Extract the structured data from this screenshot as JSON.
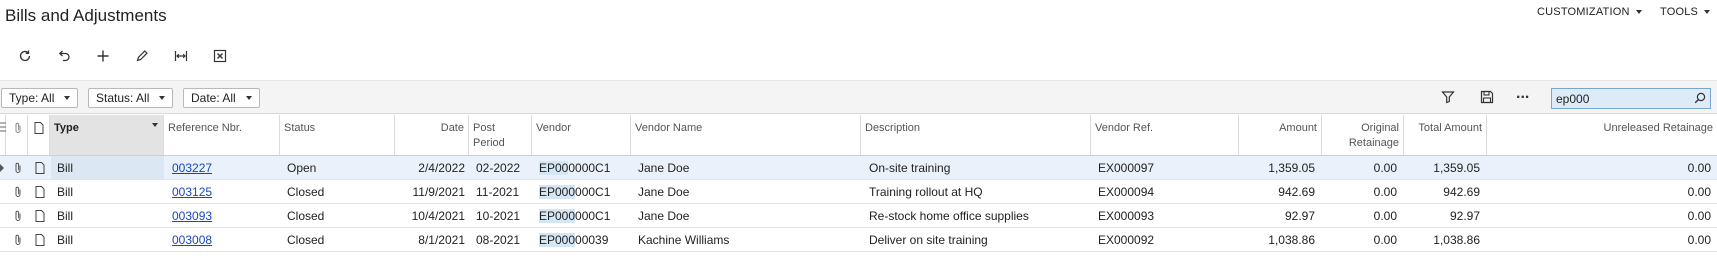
{
  "page": {
    "title": "Bills and Adjustments"
  },
  "top_menu": {
    "customization": "CUSTOMIZATION",
    "tools": "TOOLS"
  },
  "toolbar": [
    "refresh-icon",
    "undo-icon",
    "add-icon",
    "edit-icon",
    "fit-columns-icon",
    "export-excel-icon"
  ],
  "filters": {
    "type": "Type: All",
    "status": "Status: All",
    "date": "Date: All"
  },
  "search": {
    "value": "ep000",
    "more_label": "..."
  },
  "columns": {
    "type": "Type",
    "ref": "Reference Nbr.",
    "status": "Status",
    "date": "Date",
    "post_period": "Post Period",
    "vendor": "Vendor",
    "vendor_name": "Vendor Name",
    "description": "Description",
    "vendor_ref": "Vendor Ref.",
    "amount": "Amount",
    "orig_retainage": "Original Retainage",
    "total_amount": "Total Amount",
    "unreleased_retainage": "Unreleased Retainage"
  },
  "rows": [
    {
      "type": "Bill",
      "ref": "003227",
      "status": "Open",
      "date": "2/4/2022",
      "post_period": "02-2022",
      "vendor_hl": "EP00",
      "vendor_rest": "0000C1",
      "vendor_name": "Jane Doe",
      "description": "On-site training",
      "vendor_ref": "EX000097",
      "amount": "1,359.05",
      "orig_retainage": "0.00",
      "total_amount": "1,359.05",
      "unreleased_retainage": "0.00"
    },
    {
      "type": "Bill",
      "ref": "003125",
      "status": "Closed",
      "date": "11/9/2021",
      "post_period": "11-2021",
      "vendor_hl": "EP000",
      "vendor_rest": "000C1",
      "vendor_name": "Jane Doe",
      "description": "Training rollout at HQ",
      "vendor_ref": "EX000094",
      "amount": "942.69",
      "orig_retainage": "0.00",
      "total_amount": "942.69",
      "unreleased_retainage": "0.00"
    },
    {
      "type": "Bill",
      "ref": "003093",
      "status": "Closed",
      "date": "10/4/2021",
      "post_period": "10-2021",
      "vendor_hl": "EP000",
      "vendor_rest": "000C1",
      "vendor_name": "Jane Doe",
      "description": "Re-stock home office supplies",
      "vendor_ref": "EX000093",
      "amount": "92.97",
      "orig_retainage": "0.00",
      "total_amount": "92.97",
      "unreleased_retainage": "0.00"
    },
    {
      "type": "Bill",
      "ref": "003008",
      "status": "Closed",
      "date": "8/1/2021",
      "post_period": "08-2021",
      "vendor_hl": "EP000",
      "vendor_rest": "00039",
      "vendor_name": "Kachine Williams",
      "description": "Deliver on site training",
      "vendor_ref": "EX000092",
      "amount": "1,038.86",
      "orig_retainage": "0.00",
      "total_amount": "1,038.86",
      "unreleased_retainage": "0.00"
    }
  ]
}
